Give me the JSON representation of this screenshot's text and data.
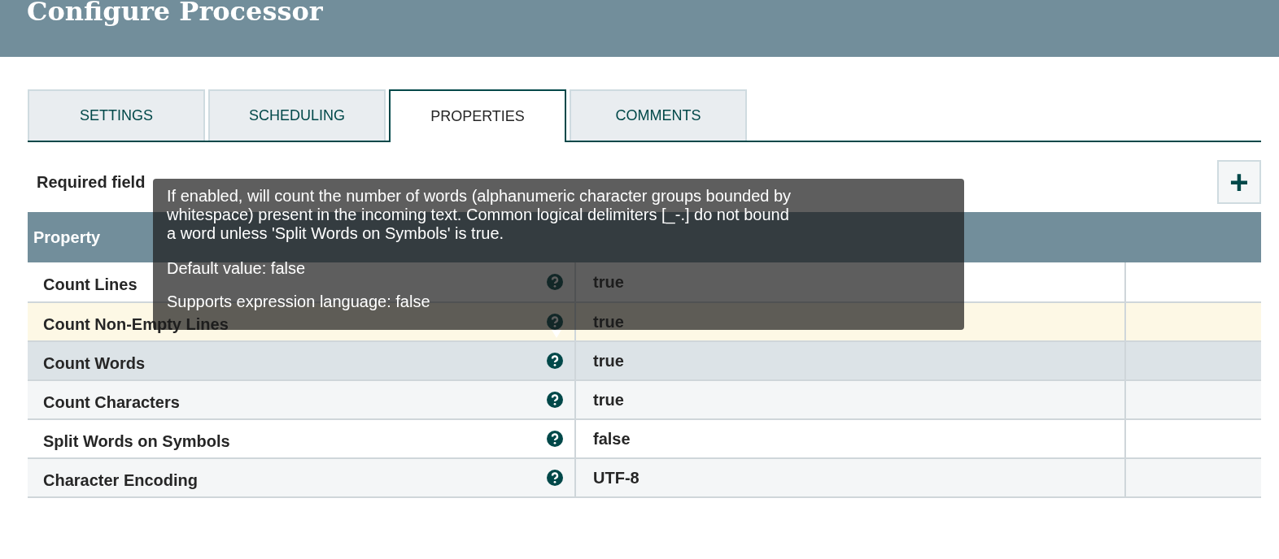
{
  "dialog": {
    "title": "Configure Processor"
  },
  "tabs": [
    {
      "label": "SETTINGS",
      "selected": false
    },
    {
      "label": "SCHEDULING",
      "selected": false
    },
    {
      "label": "PROPERTIES",
      "selected": true
    },
    {
      "label": "COMMENTS",
      "selected": false
    }
  ],
  "required_note": "Required field",
  "add_button": {
    "label": "+"
  },
  "table": {
    "columns": [
      "Property"
    ],
    "rows": [
      {
        "property": "Count Lines",
        "value": "true",
        "modified": false,
        "hovered": false
      },
      {
        "property": "Count Non-Empty Lines",
        "value": "true",
        "modified": true,
        "hovered": false
      },
      {
        "property": "Count Words",
        "value": "true",
        "modified": false,
        "hovered": true
      },
      {
        "property": "Count Characters",
        "value": "true",
        "modified": false,
        "hovered": false
      },
      {
        "property": "Split Words on Symbols",
        "value": "false",
        "modified": false,
        "hovered": false
      },
      {
        "property": "Character Encoding",
        "value": "UTF-8",
        "modified": false,
        "hovered": false
      }
    ]
  },
  "tooltip": {
    "description": "If enabled, will count the number of words (alphanumeric character groups bounded by whitespace) present in the incoming text. Common logical delimiters [_-.] do not bound a word unless 'Split Words on Symbols' is true.",
    "default_value": "Default value: false",
    "expression_language": "Supports expression language: false"
  }
}
